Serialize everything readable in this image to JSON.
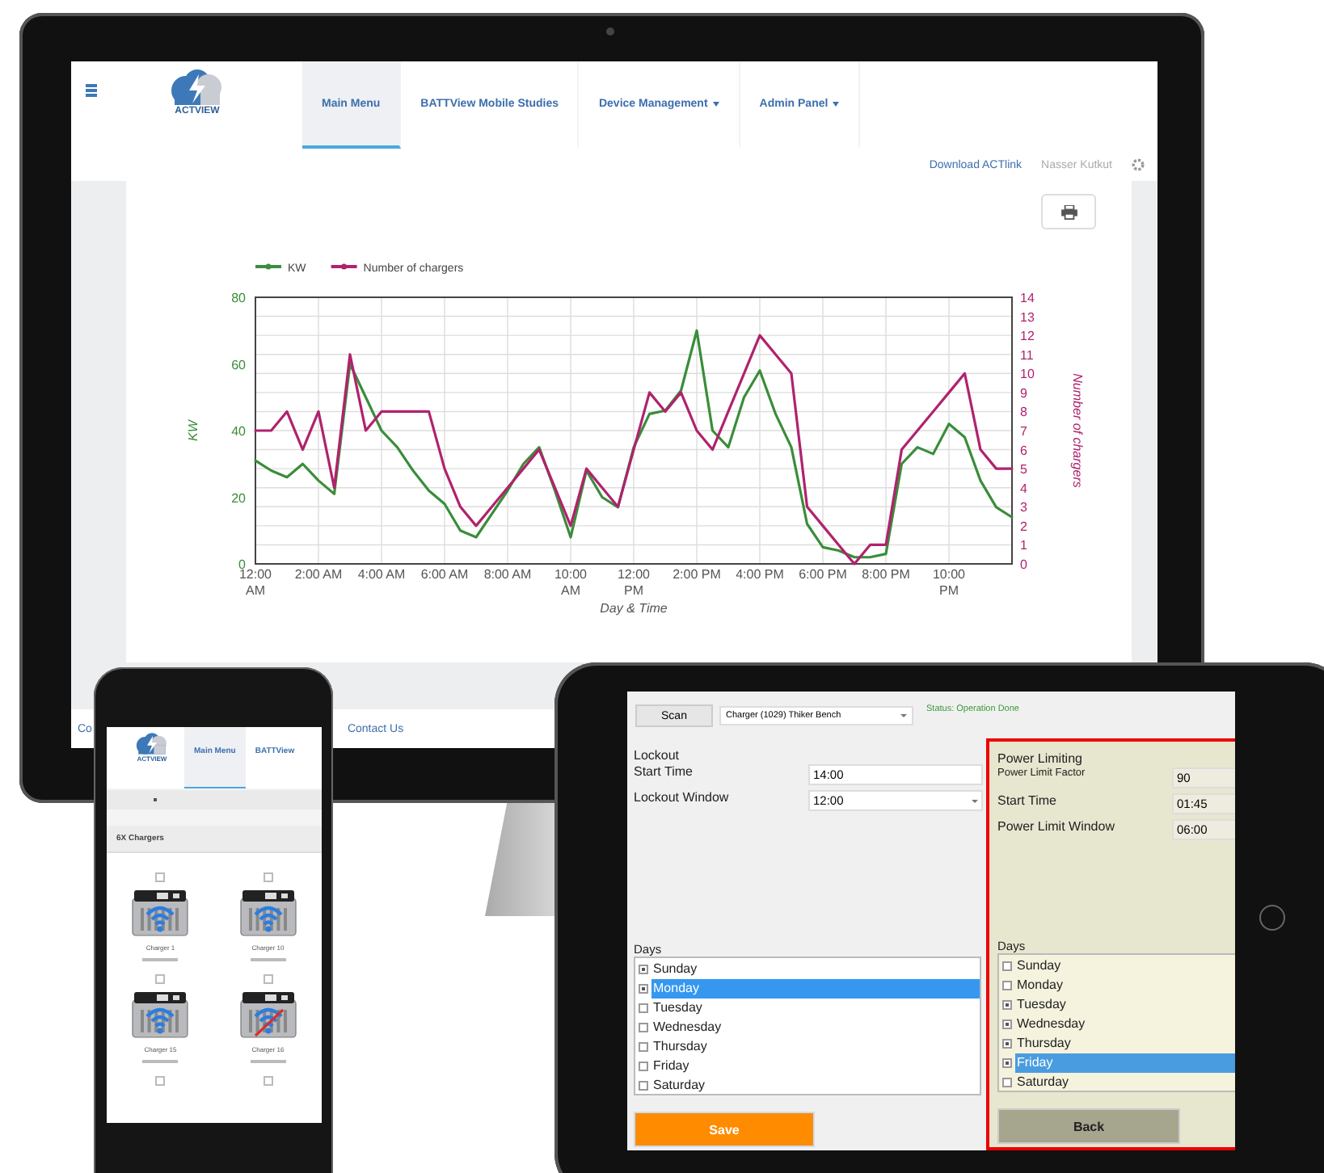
{
  "monitor": {
    "nav": {
      "logo_text": "ACTVIEW",
      "tabs": [
        {
          "label": "Main Menu",
          "selected": true,
          "dropdown": false
        },
        {
          "label": "BATTView Mobile Studies",
          "selected": false,
          "dropdown": false
        },
        {
          "label": "Device Management",
          "selected": false,
          "dropdown": true
        },
        {
          "label": "Admin Panel",
          "selected": false,
          "dropdown": true
        }
      ]
    },
    "download_link": "Download ACTlink",
    "user": "Nasser Kutkut",
    "chart_data": {
      "type": "line",
      "xlabel": "Day & Time",
      "ylabel": "KW",
      "y2label": "Number of chargers",
      "x": [
        0,
        0.5,
        1,
        1.5,
        2,
        2.5,
        3,
        3.5,
        4,
        4.5,
        5,
        5.5,
        6,
        6.5,
        7,
        7.5,
        8,
        8.5,
        9,
        9.5,
        10,
        10.5,
        11,
        11.5,
        12,
        12.5,
        13,
        13.5,
        14,
        14.5,
        15,
        15.5,
        16,
        16.5,
        17,
        17.5,
        18,
        18.5,
        19,
        19.5,
        20,
        20.5,
        21,
        21.5,
        22,
        22.5,
        23,
        23.5,
        24
      ],
      "series": [
        {
          "name": "KW",
          "color": "#3a8d3a",
          "values": [
            31,
            28,
            26,
            30,
            25,
            21,
            60,
            50,
            40,
            35,
            28,
            22,
            18,
            10,
            8,
            15,
            22,
            30,
            35,
            22,
            8,
            28,
            20,
            17,
            35,
            45,
            46,
            52,
            70,
            40,
            35,
            50,
            58,
            45,
            35,
            12,
            5,
            4,
            2,
            2,
            3,
            30,
            35,
            33,
            42,
            38,
            25,
            17,
            14
          ]
        },
        {
          "name": "Number of chargers",
          "color": "#b0226e",
          "axis": "y2",
          "values": [
            7,
            7,
            8,
            6,
            8,
            4,
            11,
            7,
            8,
            8,
            8,
            8,
            5,
            3,
            2,
            3,
            4,
            5,
            6,
            4,
            2,
            5,
            4,
            3,
            6,
            9,
            8,
            9,
            7,
            6,
            8,
            10,
            12,
            11,
            10,
            3,
            2,
            1,
            0,
            1,
            1,
            6,
            7,
            8,
            9,
            10,
            6,
            5,
            5
          ]
        }
      ],
      "grid": true,
      "legend": "top-left",
      "xlim": [
        0,
        24
      ],
      "ylim": [
        0,
        80
      ],
      "y2lim": [
        0,
        14
      ],
      "xticks": [
        {
          "value": 0,
          "label": "12:00\nAM"
        },
        {
          "value": 2,
          "label": "2:00 AM"
        },
        {
          "value": 4,
          "label": "4:00 AM"
        },
        {
          "value": 6,
          "label": "6:00 AM"
        },
        {
          "value": 8,
          "label": "8:00 AM"
        },
        {
          "value": 10,
          "label": "10:00\nAM"
        },
        {
          "value": 12,
          "label": "12:00\nPM"
        },
        {
          "value": 14,
          "label": "2:00 PM"
        },
        {
          "value": 16,
          "label": "4:00 PM"
        },
        {
          "value": 18,
          "label": "6:00 PM"
        },
        {
          "value": 20,
          "label": "8:00 PM"
        },
        {
          "value": 22,
          "label": "10:00\nPM"
        }
      ],
      "yticks": [
        0,
        20,
        40,
        60,
        80
      ],
      "y2ticks": [
        0,
        1,
        2,
        3,
        4,
        5,
        6,
        7,
        8,
        9,
        10,
        11,
        12,
        13,
        14
      ]
    },
    "footer": [
      "Co",
      "Contact Us"
    ]
  },
  "phone": {
    "logo_text": "ACTVIEW",
    "tabs": [
      {
        "label": "Main Menu",
        "selected": true
      },
      {
        "label": "BATTView",
        "selected": false
      }
    ],
    "section_title": "6X Chargers",
    "chargers": [
      {
        "kind": "full",
        "name": "Charger 1",
        "checked": false,
        "fault": false
      },
      {
        "kind": "full",
        "name": "Charger 10",
        "checked": false,
        "fault": false
      },
      {
        "kind": "full",
        "name": "Charger 15",
        "checked": false,
        "fault": false
      },
      {
        "kind": "full",
        "name": "Charger 16",
        "checked": false,
        "fault": true
      },
      {
        "kind": "cut",
        "checked": false
      },
      {
        "kind": "cut",
        "checked": false
      }
    ]
  },
  "tablet": {
    "scan_button": "Scan",
    "charger_select": "Charger (1029) Thiker Bench",
    "status": "Status: Operation Done",
    "lockout": {
      "title": "Lockout",
      "fields": [
        {
          "label": "Start Time",
          "value": "14:00",
          "kind": "text"
        },
        {
          "label": "Lockout Window",
          "value": "12:00",
          "kind": "select"
        }
      ],
      "days_label": "Days",
      "days": [
        {
          "label": "Sunday",
          "checked": true,
          "selected": false
        },
        {
          "label": "Monday",
          "checked": true,
          "selected": true
        },
        {
          "label": "Tuesday",
          "checked": false,
          "selected": false
        },
        {
          "label": "Wednesday",
          "checked": false,
          "selected": false
        },
        {
          "label": "Thursday",
          "checked": false,
          "selected": false
        },
        {
          "label": "Friday",
          "checked": false,
          "selected": false
        },
        {
          "label": "Saturday",
          "checked": false,
          "selected": false
        }
      ]
    },
    "power_limiting": {
      "title": "Power Limiting",
      "fields": [
        {
          "label": "Power Limit Factor",
          "value": "90",
          "kind": "text"
        },
        {
          "label": "Start Time",
          "value": "01:45",
          "kind": "text"
        },
        {
          "label": "Power Limit Window",
          "value": "06:00",
          "kind": "text"
        }
      ],
      "days_label": "Days",
      "days": [
        {
          "label": "Sunday",
          "checked": false,
          "selected": false
        },
        {
          "label": "Monday",
          "checked": false,
          "selected": false
        },
        {
          "label": "Tuesday",
          "checked": true,
          "selected": false
        },
        {
          "label": "Wednesday",
          "checked": true,
          "selected": false
        },
        {
          "label": "Thursday",
          "checked": true,
          "selected": false
        },
        {
          "label": "Friday",
          "checked": true,
          "selected": true
        },
        {
          "label": "Saturday",
          "checked": false,
          "selected": false
        }
      ]
    },
    "save_button": "Save",
    "back_button": "Back"
  }
}
